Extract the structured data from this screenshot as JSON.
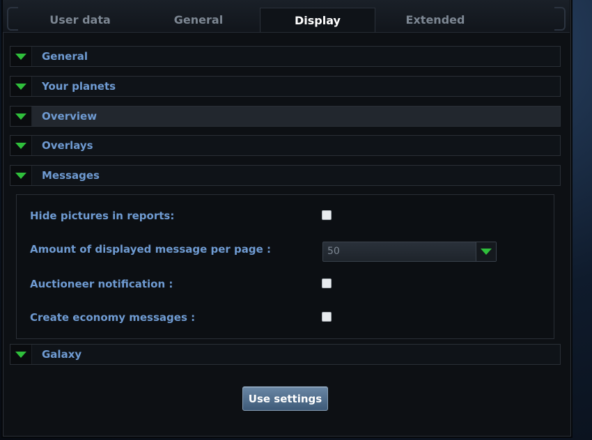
{
  "tabs": [
    {
      "label": "User data"
    },
    {
      "label": "General"
    },
    {
      "label": "Display"
    },
    {
      "label": "Extended"
    }
  ],
  "active_tab": "Display",
  "sections": [
    {
      "label": "General"
    },
    {
      "label": "Your planets"
    },
    {
      "label": "Overview"
    },
    {
      "label": "Overlays"
    },
    {
      "label": "Messages"
    },
    {
      "label": "Galaxy"
    }
  ],
  "messages_panel": {
    "hide_pictures_label": "Hide pictures in reports:",
    "hide_pictures_checked": false,
    "per_page_label": "Amount of displayed message per page :",
    "per_page_value": "50",
    "auctioneer_label": "Auctioneer notification :",
    "auctioneer_checked": false,
    "economy_label": "Create economy messages :",
    "economy_checked": false
  },
  "submit_label": "Use settings",
  "colors": {
    "accent_green": "#2fbf3b",
    "label_blue": "#6f9bd2"
  },
  "icons": {
    "expand": "triangle-down-icon"
  }
}
